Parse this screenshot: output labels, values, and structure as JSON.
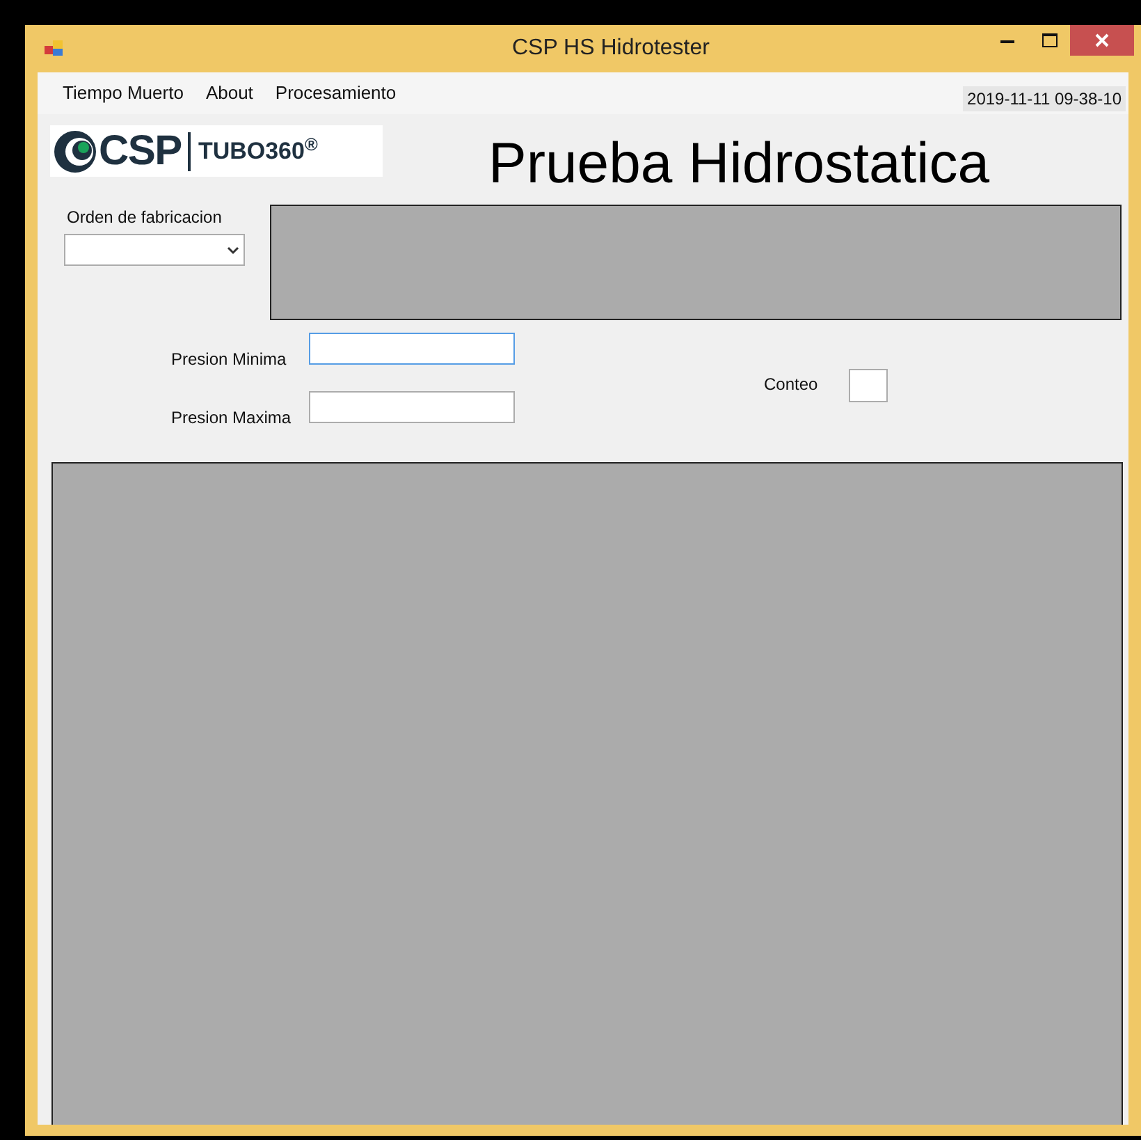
{
  "window": {
    "title": "CSP HS Hidrotester"
  },
  "menu": [
    "Tiempo Muerto",
    "About",
    "Procesamiento"
  ],
  "datetime": "2019-11-11 09-38-10",
  "logo": {
    "brand": "CSP",
    "product": "TUBO360$^{®}$"
  },
  "heading": "Prueba Hidrostatica",
  "order": {
    "label": "Orden de fabricacion"
  },
  "pressure_fields": [
    {
      "label": "Presion Minima",
      "focused": true
    },
    {
      "label": "Presion Maxima",
      "focused": false
    }
  ],
  "count": {
    "label": "Conteo"
  }
}
